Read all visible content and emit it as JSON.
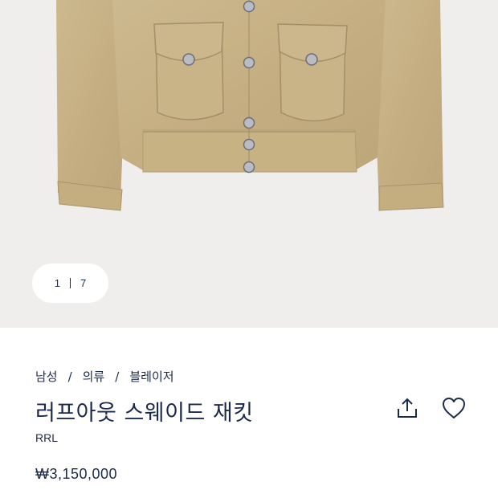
{
  "gallery": {
    "current_index": "1",
    "total": "7"
  },
  "breadcrumb": [
    "남성",
    "의류",
    "블레이저"
  ],
  "breadcrumb_separator": "/",
  "product": {
    "title": "러프아웃 스웨이드 재킷",
    "brand": "RRL",
    "price": "₩3,150,000"
  },
  "icons": {
    "share": "share-icon",
    "wishlist": "heart-icon"
  },
  "colors": {
    "text": "#1c2a4a",
    "image_bg": "#efeeec",
    "jacket": "#c9b48a"
  }
}
